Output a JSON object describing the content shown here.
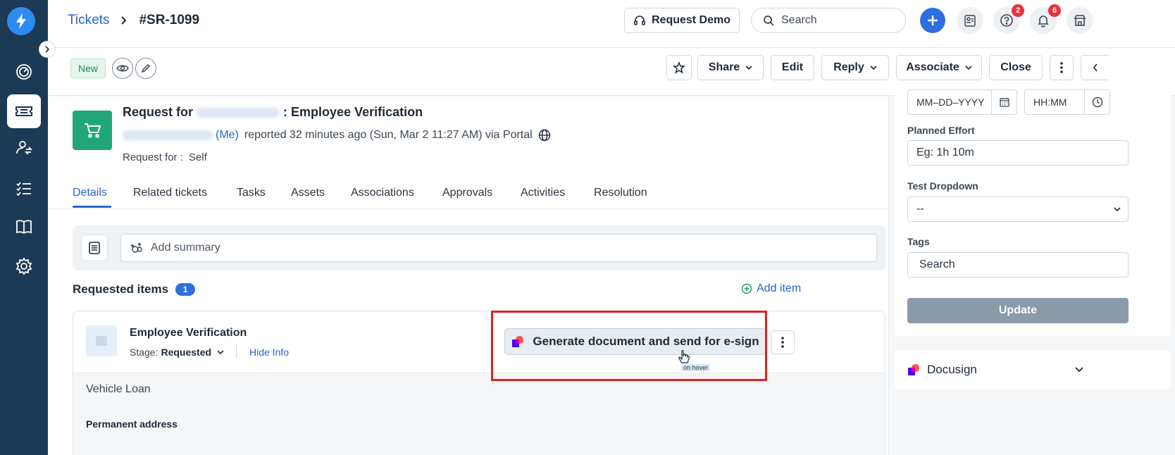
{
  "header": {
    "breadcrumb_root": "Tickets",
    "breadcrumb_current": "#SR-1099",
    "request_demo_label": "Request Demo",
    "search_placeholder": "Search",
    "help_badge": "2",
    "notifications_badge": "6"
  },
  "actionbar": {
    "status_label": "New",
    "share_label": "Share",
    "edit_label": "Edit",
    "reply_label": "Reply",
    "associate_label": "Associate",
    "close_label": "Close"
  },
  "ticket": {
    "title_prefix": "Request for",
    "title_suffix": ": Employee Verification",
    "me_label": "(Me)",
    "reported_text": "reported 32 minutes ago (Sun, Mar 2 11:27 AM) via Portal",
    "request_for_label": "Request for :",
    "request_for_value": "Self"
  },
  "tabs": [
    {
      "label": "Details"
    },
    {
      "label": "Related tickets"
    },
    {
      "label": "Tasks"
    },
    {
      "label": "Assets"
    },
    {
      "label": "Associations"
    },
    {
      "label": "Approvals"
    },
    {
      "label": "Activities"
    },
    {
      "label": "Resolution"
    }
  ],
  "summary": {
    "placeholder": "Add summary"
  },
  "requested_items": {
    "heading": "Requested items",
    "count": "1",
    "add_item_label": "Add item",
    "item_name": "Employee Verification",
    "stage_label": "Stage:",
    "stage_value": "Requested",
    "hide_info_label": "Hide Info",
    "generate_label": "Generate document and send for e-sign",
    "hover_note": "on hover",
    "vehicle_loan": "Vehicle Loan",
    "permanent_address_label": "Permanent address"
  },
  "right_panel": {
    "date_placeholder": "MM–DD–YYYY",
    "time_placeholder": "HH:MM",
    "planned_effort_label": "Planned Effort",
    "planned_effort_placeholder": "Eg: 1h 10m",
    "test_dropdown_label": "Test Dropdown",
    "test_dropdown_value": "--",
    "tags_label": "Tags",
    "tags_placeholder": "Search",
    "update_label": "Update",
    "docusign_label": "Docusign"
  },
  "colors": {
    "nav_bg": "#1b3a55",
    "accent_blue": "#2563c9",
    "status_green": "#1e8a52",
    "highlight_red": "#e0211c",
    "badge_red": "#e5343f"
  }
}
